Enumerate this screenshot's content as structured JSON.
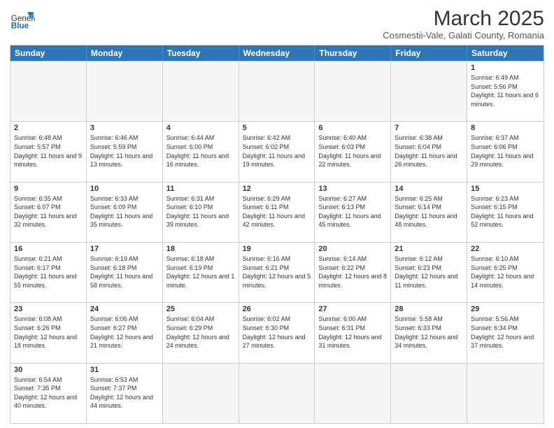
{
  "header": {
    "logo_general": "General",
    "logo_blue": "Blue",
    "month_title": "March 2025",
    "subtitle": "Cosmestii-Vale, Galati County, Romania"
  },
  "weekdays": [
    "Sunday",
    "Monday",
    "Tuesday",
    "Wednesday",
    "Thursday",
    "Friday",
    "Saturday"
  ],
  "rows": [
    [
      {
        "day": "",
        "info": ""
      },
      {
        "day": "",
        "info": ""
      },
      {
        "day": "",
        "info": ""
      },
      {
        "day": "",
        "info": ""
      },
      {
        "day": "",
        "info": ""
      },
      {
        "day": "",
        "info": ""
      },
      {
        "day": "1",
        "info": "Sunrise: 6:49 AM\nSunset: 5:56 PM\nDaylight: 11 hours and 6 minutes."
      }
    ],
    [
      {
        "day": "2",
        "info": "Sunrise: 6:48 AM\nSunset: 5:57 PM\nDaylight: 11 hours and 9 minutes."
      },
      {
        "day": "3",
        "info": "Sunrise: 6:46 AM\nSunset: 5:59 PM\nDaylight: 11 hours and 13 minutes."
      },
      {
        "day": "4",
        "info": "Sunrise: 6:44 AM\nSunset: 6:00 PM\nDaylight: 11 hours and 16 minutes."
      },
      {
        "day": "5",
        "info": "Sunrise: 6:42 AM\nSunset: 6:02 PM\nDaylight: 11 hours and 19 minutes."
      },
      {
        "day": "6",
        "info": "Sunrise: 6:40 AM\nSunset: 6:03 PM\nDaylight: 11 hours and 22 minutes."
      },
      {
        "day": "7",
        "info": "Sunrise: 6:38 AM\nSunset: 6:04 PM\nDaylight: 11 hours and 26 minutes."
      },
      {
        "day": "8",
        "info": "Sunrise: 6:37 AM\nSunset: 6:06 PM\nDaylight: 11 hours and 29 minutes."
      }
    ],
    [
      {
        "day": "9",
        "info": "Sunrise: 6:35 AM\nSunset: 6:07 PM\nDaylight: 11 hours and 32 minutes."
      },
      {
        "day": "10",
        "info": "Sunrise: 6:33 AM\nSunset: 6:09 PM\nDaylight: 11 hours and 35 minutes."
      },
      {
        "day": "11",
        "info": "Sunrise: 6:31 AM\nSunset: 6:10 PM\nDaylight: 11 hours and 39 minutes."
      },
      {
        "day": "12",
        "info": "Sunrise: 6:29 AM\nSunset: 6:11 PM\nDaylight: 11 hours and 42 minutes."
      },
      {
        "day": "13",
        "info": "Sunrise: 6:27 AM\nSunset: 6:13 PM\nDaylight: 11 hours and 45 minutes."
      },
      {
        "day": "14",
        "info": "Sunrise: 6:25 AM\nSunset: 6:14 PM\nDaylight: 11 hours and 48 minutes."
      },
      {
        "day": "15",
        "info": "Sunrise: 6:23 AM\nSunset: 6:15 PM\nDaylight: 11 hours and 52 minutes."
      }
    ],
    [
      {
        "day": "16",
        "info": "Sunrise: 6:21 AM\nSunset: 6:17 PM\nDaylight: 11 hours and 55 minutes."
      },
      {
        "day": "17",
        "info": "Sunrise: 6:19 AM\nSunset: 6:18 PM\nDaylight: 11 hours and 58 minutes."
      },
      {
        "day": "18",
        "info": "Sunrise: 6:18 AM\nSunset: 6:19 PM\nDaylight: 12 hours and 1 minute."
      },
      {
        "day": "19",
        "info": "Sunrise: 6:16 AM\nSunset: 6:21 PM\nDaylight: 12 hours and 5 minutes."
      },
      {
        "day": "20",
        "info": "Sunrise: 6:14 AM\nSunset: 6:22 PM\nDaylight: 12 hours and 8 minutes."
      },
      {
        "day": "21",
        "info": "Sunrise: 6:12 AM\nSunset: 6:23 PM\nDaylight: 12 hours and 11 minutes."
      },
      {
        "day": "22",
        "info": "Sunrise: 6:10 AM\nSunset: 6:25 PM\nDaylight: 12 hours and 14 minutes."
      }
    ],
    [
      {
        "day": "23",
        "info": "Sunrise: 6:08 AM\nSunset: 6:26 PM\nDaylight: 12 hours and 18 minutes."
      },
      {
        "day": "24",
        "info": "Sunrise: 6:06 AM\nSunset: 6:27 PM\nDaylight: 12 hours and 21 minutes."
      },
      {
        "day": "25",
        "info": "Sunrise: 6:04 AM\nSunset: 6:29 PM\nDaylight: 12 hours and 24 minutes."
      },
      {
        "day": "26",
        "info": "Sunrise: 6:02 AM\nSunset: 6:30 PM\nDaylight: 12 hours and 27 minutes."
      },
      {
        "day": "27",
        "info": "Sunrise: 6:00 AM\nSunset: 6:31 PM\nDaylight: 12 hours and 31 minutes."
      },
      {
        "day": "28",
        "info": "Sunrise: 5:58 AM\nSunset: 6:33 PM\nDaylight: 12 hours and 34 minutes."
      },
      {
        "day": "29",
        "info": "Sunrise: 5:56 AM\nSunset: 6:34 PM\nDaylight: 12 hours and 37 minutes."
      }
    ],
    [
      {
        "day": "30",
        "info": "Sunrise: 6:54 AM\nSunset: 7:35 PM\nDaylight: 12 hours and 40 minutes."
      },
      {
        "day": "31",
        "info": "Sunrise: 6:53 AM\nSunset: 7:37 PM\nDaylight: 12 hours and 44 minutes."
      },
      {
        "day": "",
        "info": ""
      },
      {
        "day": "",
        "info": ""
      },
      {
        "day": "",
        "info": ""
      },
      {
        "day": "",
        "info": ""
      },
      {
        "day": "",
        "info": ""
      }
    ]
  ]
}
